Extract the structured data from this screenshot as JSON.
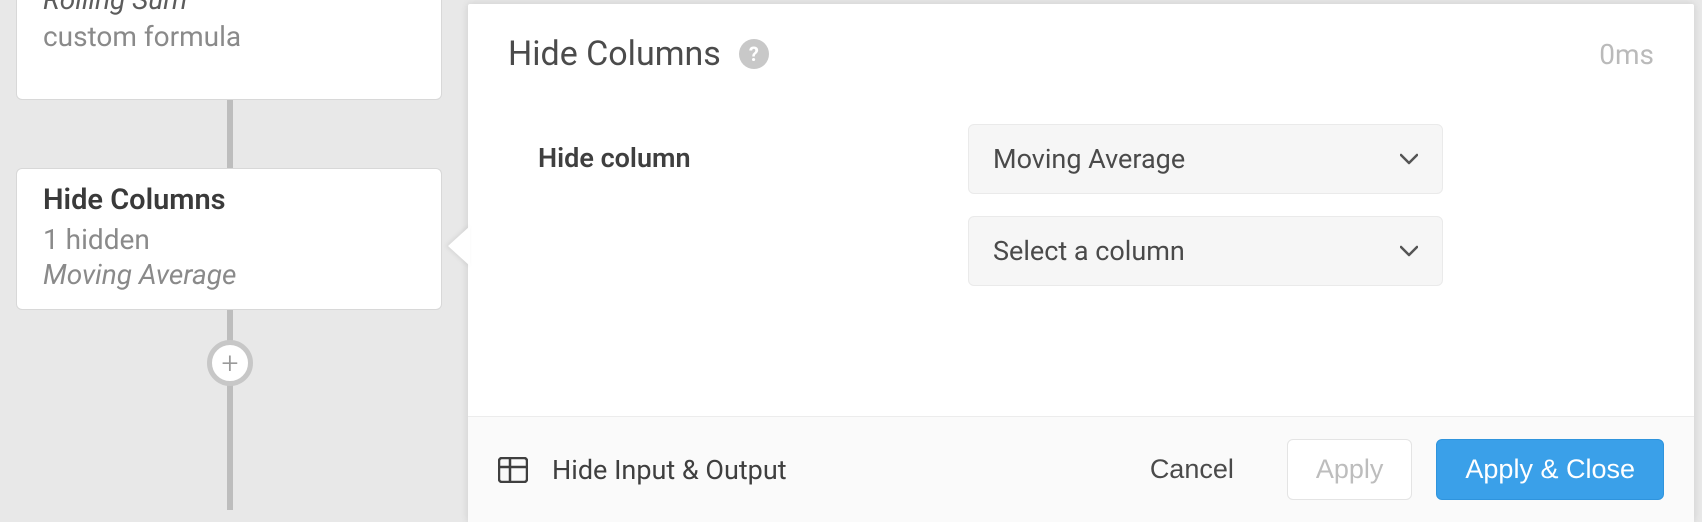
{
  "flow": {
    "node_top": {
      "title": "Rolling Sum",
      "subtitle": "custom formula"
    },
    "node_selected": {
      "title": "Hide Columns",
      "line1": "1 hidden",
      "line2": "Moving Average"
    }
  },
  "panel": {
    "title": "Hide Columns",
    "timing": "0ms",
    "form": {
      "label": "Hide column",
      "select1": "Moving Average",
      "select2": "Select a column"
    },
    "footer": {
      "toggle_label": "Hide Input & Output",
      "cancel": "Cancel",
      "apply": "Apply",
      "apply_close": "Apply & Close"
    }
  }
}
